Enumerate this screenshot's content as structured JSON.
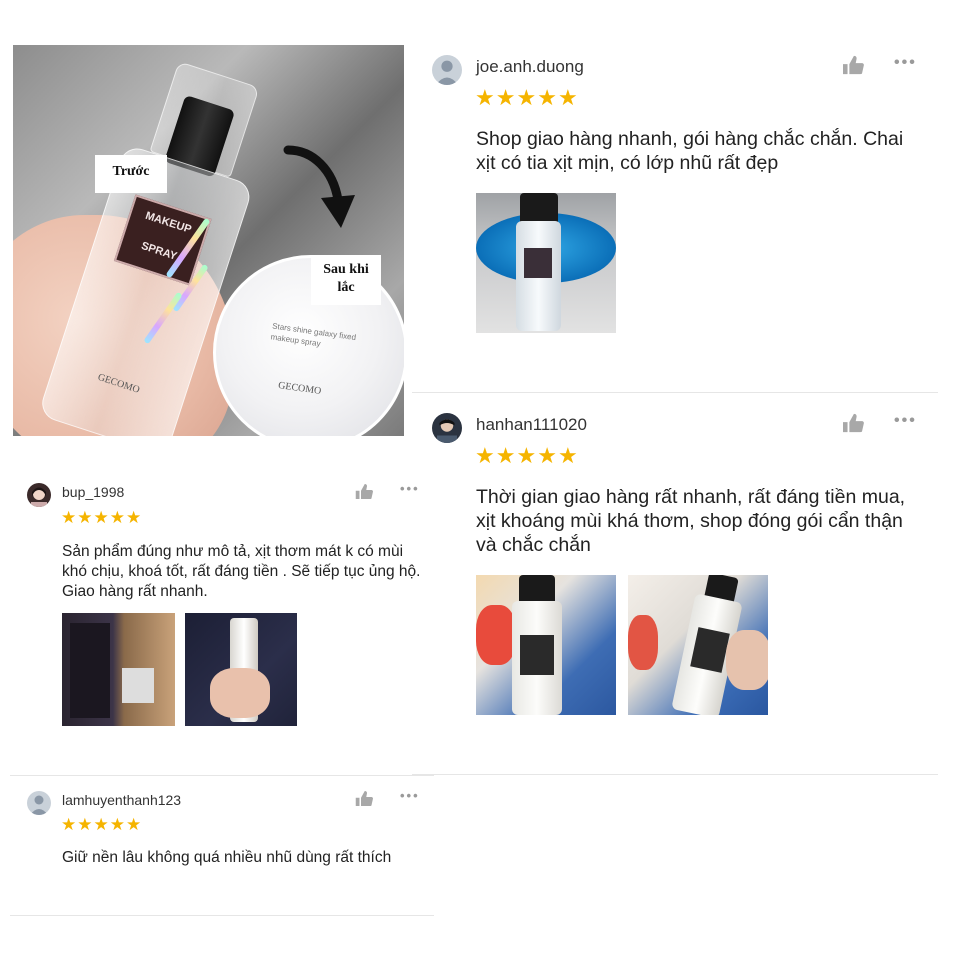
{
  "hero": {
    "before_label": "Trước",
    "after_label_line1": "Sau khi",
    "after_label_line2": "lắc",
    "bottle_label": "MAKEUP SPRAY",
    "bottle_brand": "GECOMO",
    "zoom_text": "Stars shine galaxy fixed makeup spray",
    "zoom_brand": "GECOMO"
  },
  "reviews": [
    {
      "username": "bup_1998",
      "rating": 5,
      "stars": "★★★★★",
      "comment": "Sản phẩm đúng như mô tả, xịt thơm mát k có mùi khó chịu, khoá tốt, rất đáng tiền . Sẽ tiếp tục ủng hộ. Giao hàng rất nhanh.",
      "more": "•••"
    },
    {
      "username": "lamhuyenthanh123",
      "rating": 5,
      "stars": "★★★★★",
      "comment": "Giữ nền lâu không quá nhiều nhũ dùng rất thích",
      "more": "•••"
    },
    {
      "username": "joe.anh.duong",
      "rating": 5,
      "stars": "★★★★★",
      "comment": "Shop giao hàng nhanh, gói hàng chắc chắn. Chai xịt có tia xịt mịn, có lớp nhũ rất đẹp",
      "more": "•••"
    },
    {
      "username": "hanhan111020",
      "rating": 5,
      "stars": "★★★★★",
      "comment": "Thời gian giao hàng rất nhanh, rất đáng tiền mua, xịt khoáng mùi khá thơm, shop đóng gói cẩn thận và chắc chắn",
      "more": "•••"
    }
  ],
  "icons": {
    "like": "thumbs-up-icon",
    "more": "more-options-icon",
    "avatar_default": "default-user-avatar-icon"
  },
  "colors": {
    "star": "#f5b400",
    "icon_gray": "#9a9a9a",
    "divider": "#e6e6e6",
    "avatar_bg": "#c9d1d9"
  }
}
